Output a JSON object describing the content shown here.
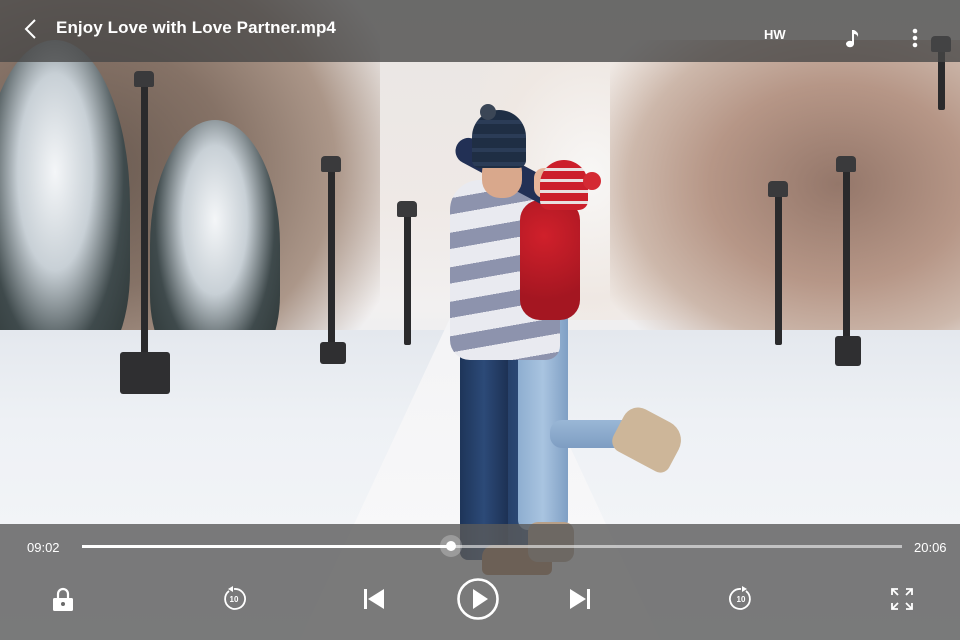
{
  "header": {
    "title": "Enjoy Love with Love Partner.mp4",
    "hw_label": "HW"
  },
  "playback": {
    "current_time": "09:02",
    "total_time": "20:06",
    "progress": 0.4494
  },
  "controls": {
    "rewind_seconds": "10",
    "forward_seconds": "10"
  },
  "icons": {
    "back": "back-arrow-icon",
    "music": "music-note-icon",
    "more": "more-vertical-icon",
    "lock": "lock-icon",
    "rewind": "rewind-10-icon",
    "previous": "skip-previous-icon",
    "play": "play-icon",
    "next": "skip-next-icon",
    "forward": "forward-10-icon",
    "fullscreen": "fullscreen-icon"
  },
  "colors": {
    "overlay": "#464646",
    "icon": "#ffffff"
  }
}
